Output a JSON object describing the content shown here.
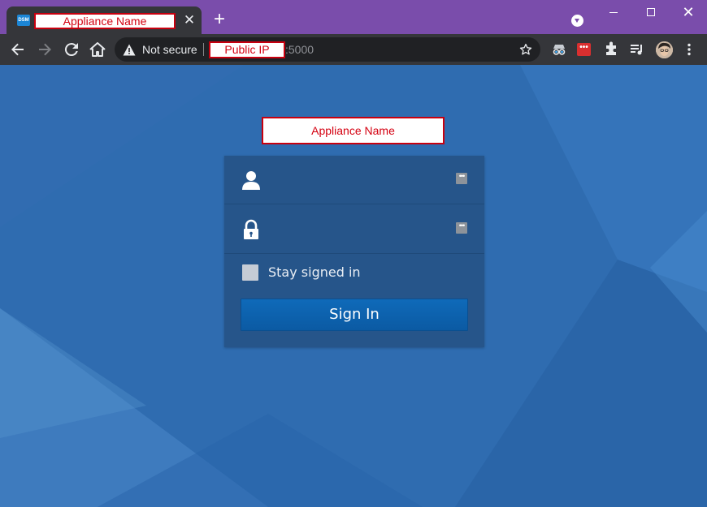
{
  "browser": {
    "tab": {
      "favicon_text": "DSM",
      "title": "Appliance Name",
      "close_glyph": "✕"
    },
    "new_tab_glyph": "+",
    "window_close_glyph": "✕",
    "address": {
      "security_text": "Not secure",
      "host": "Public IP",
      "port": ":5000"
    },
    "extensions": {
      "password_badge": "•••"
    },
    "colors": {
      "frame": "#7a4dab",
      "toolbar": "#35363a",
      "omnibox": "#202124"
    }
  },
  "login": {
    "appliance_name": "Appliance Name",
    "username_placeholder": "",
    "password_placeholder": "",
    "pw_manager_glyph": "•••",
    "stay_signed_in": "Stay signed in",
    "sign_in": "Sign In",
    "colors": {
      "background": "#2f6cb0",
      "panel": "#26558a",
      "button": "#0f6ab9",
      "highlight_border": "#c8000f"
    }
  }
}
